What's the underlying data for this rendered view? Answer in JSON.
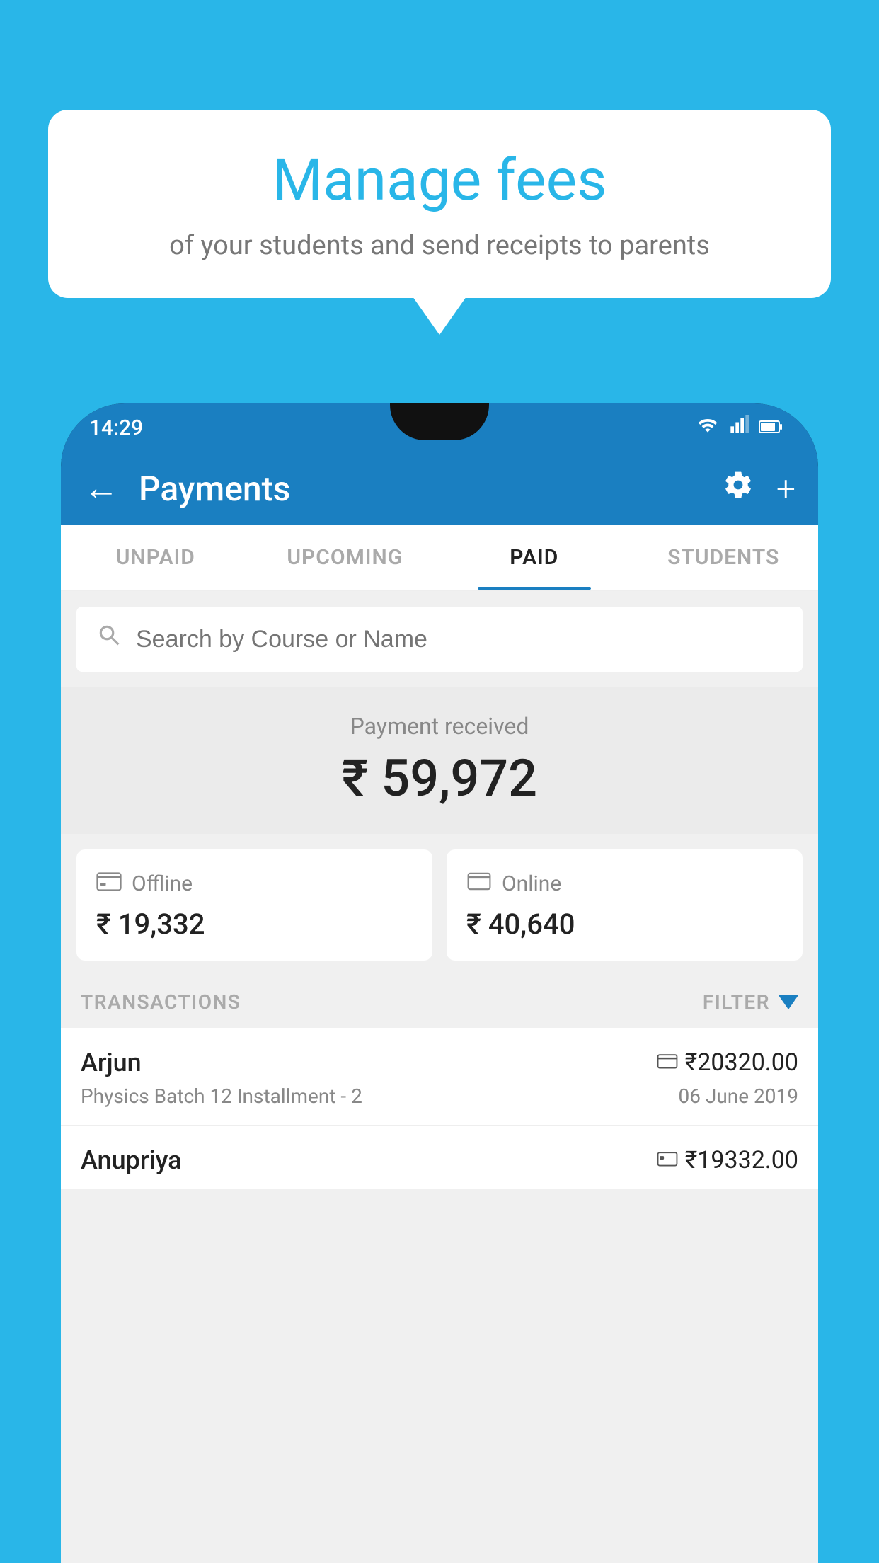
{
  "background_color": "#29B6E8",
  "speech_bubble": {
    "title": "Manage fees",
    "subtitle": "of your students and send receipts to parents"
  },
  "status_bar": {
    "time": "14:29"
  },
  "app_bar": {
    "title": "Payments",
    "back_label": "←",
    "settings_label": "⚙",
    "add_label": "+"
  },
  "tabs": [
    {
      "id": "unpaid",
      "label": "UNPAID",
      "active": false
    },
    {
      "id": "upcoming",
      "label": "UPCOMING",
      "active": false
    },
    {
      "id": "paid",
      "label": "PAID",
      "active": true
    },
    {
      "id": "students",
      "label": "STUDENTS",
      "active": false
    }
  ],
  "search": {
    "placeholder": "Search by Course or Name"
  },
  "payment_received": {
    "label": "Payment received",
    "amount": "₹ 59,972"
  },
  "cards": [
    {
      "icon": "offline-payment-icon",
      "label": "Offline",
      "amount": "₹ 19,332"
    },
    {
      "icon": "online-payment-icon",
      "label": "Online",
      "amount": "₹ 40,640"
    }
  ],
  "transactions_section": {
    "label": "TRANSACTIONS",
    "filter_label": "FILTER"
  },
  "transactions": [
    {
      "name": "Arjun",
      "payment_type_icon": "card-icon",
      "amount": "₹20320.00",
      "course": "Physics Batch 12 Installment - 2",
      "date": "06 June 2019"
    },
    {
      "name": "Anupriya",
      "payment_type_icon": "cash-icon",
      "amount": "₹19332.00",
      "course": "",
      "date": ""
    }
  ]
}
